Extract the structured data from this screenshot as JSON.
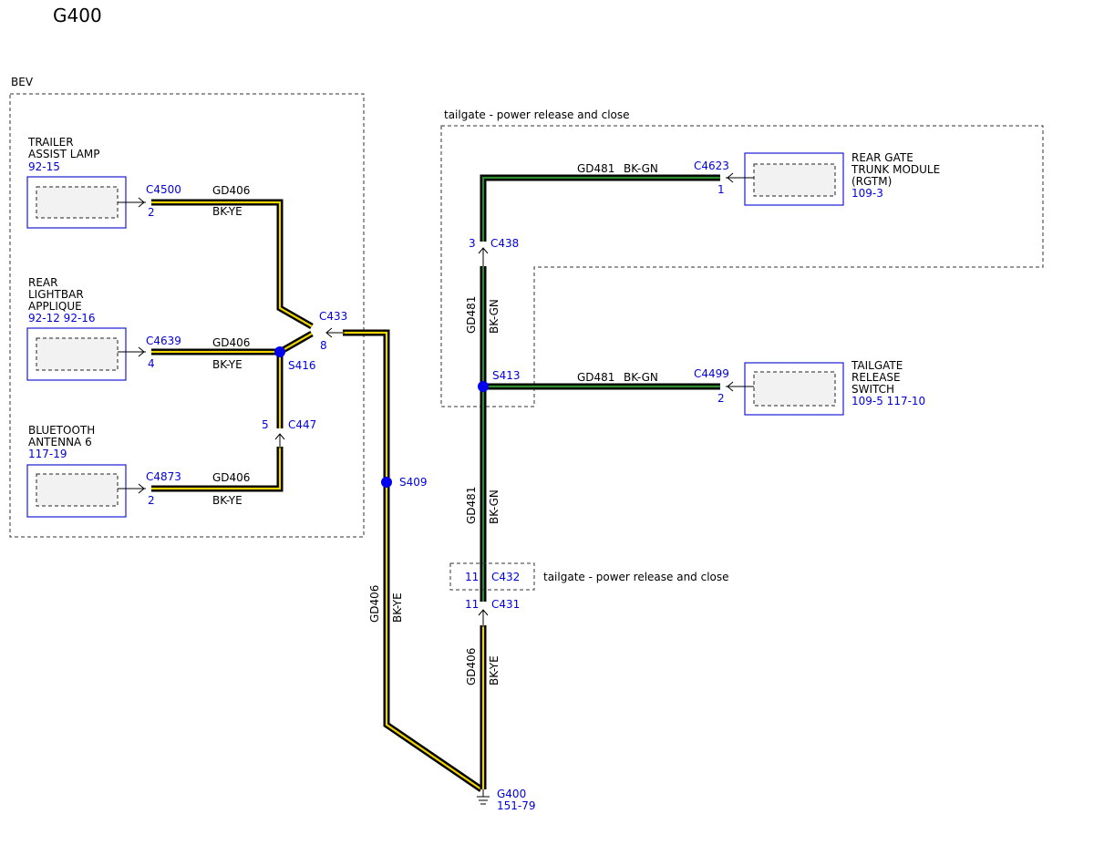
{
  "title": "G400",
  "regions": {
    "bev": "BEV",
    "tailgate_top": "tailgate - power release and close",
    "tailgate_c432": "tailgate - power release and close"
  },
  "components": {
    "trailer_lamp": {
      "name_lines": [
        "TRAILER",
        "ASSIST LAMP"
      ],
      "ref": "92-15"
    },
    "lightbar": {
      "name_lines": [
        "REAR",
        "LIGHTBAR",
        "APPLIQUE"
      ],
      "ref": "92-12 92-16"
    },
    "bluetooth": {
      "name_lines": [
        "BLUETOOTH",
        "ANTENNA 6"
      ],
      "ref": "117-19"
    },
    "rgtm": {
      "name_lines": [
        "REAR GATE",
        "TRUNK MODULE",
        "(RGTM)"
      ],
      "ref": "109-3"
    },
    "release_switch": {
      "name_lines": [
        "TAILGATE",
        "RELEASE",
        "SWITCH"
      ],
      "ref": "109-5  117-10"
    },
    "ground": {
      "name": "G400",
      "ref": "151-79"
    }
  },
  "connectors": {
    "c4500": {
      "id": "C4500",
      "pin": "2"
    },
    "c4639": {
      "id": "C4639",
      "pin": "4"
    },
    "c4873": {
      "id": "C4873",
      "pin": "2"
    },
    "c447": {
      "id": "C447",
      "pin": "5"
    },
    "c433": {
      "id": "C433",
      "pin": "8"
    },
    "c4623": {
      "id": "C4623",
      "pin": "1"
    },
    "c438": {
      "id": "C438",
      "pin": "3"
    },
    "c4499": {
      "id": "C4499",
      "pin": "2"
    },
    "c432": {
      "id": "C432",
      "pin": "11"
    },
    "c431": {
      "id": "C431",
      "pin": "11"
    }
  },
  "splices": {
    "s416": "S416",
    "s409": "S409",
    "s413": "S413"
  },
  "wires": {
    "gd406": {
      "circuit": "GD406",
      "color": "BK-YE"
    },
    "gd481": {
      "circuit": "GD481",
      "color": "BK-GN"
    }
  },
  "colors": {
    "ref_text": "#0000dd",
    "wire_bk_ye_stripe": "#f0d400",
    "wire_bk_gn_stripe": "#2e8b2e",
    "splice_dot": "#0000ee"
  }
}
